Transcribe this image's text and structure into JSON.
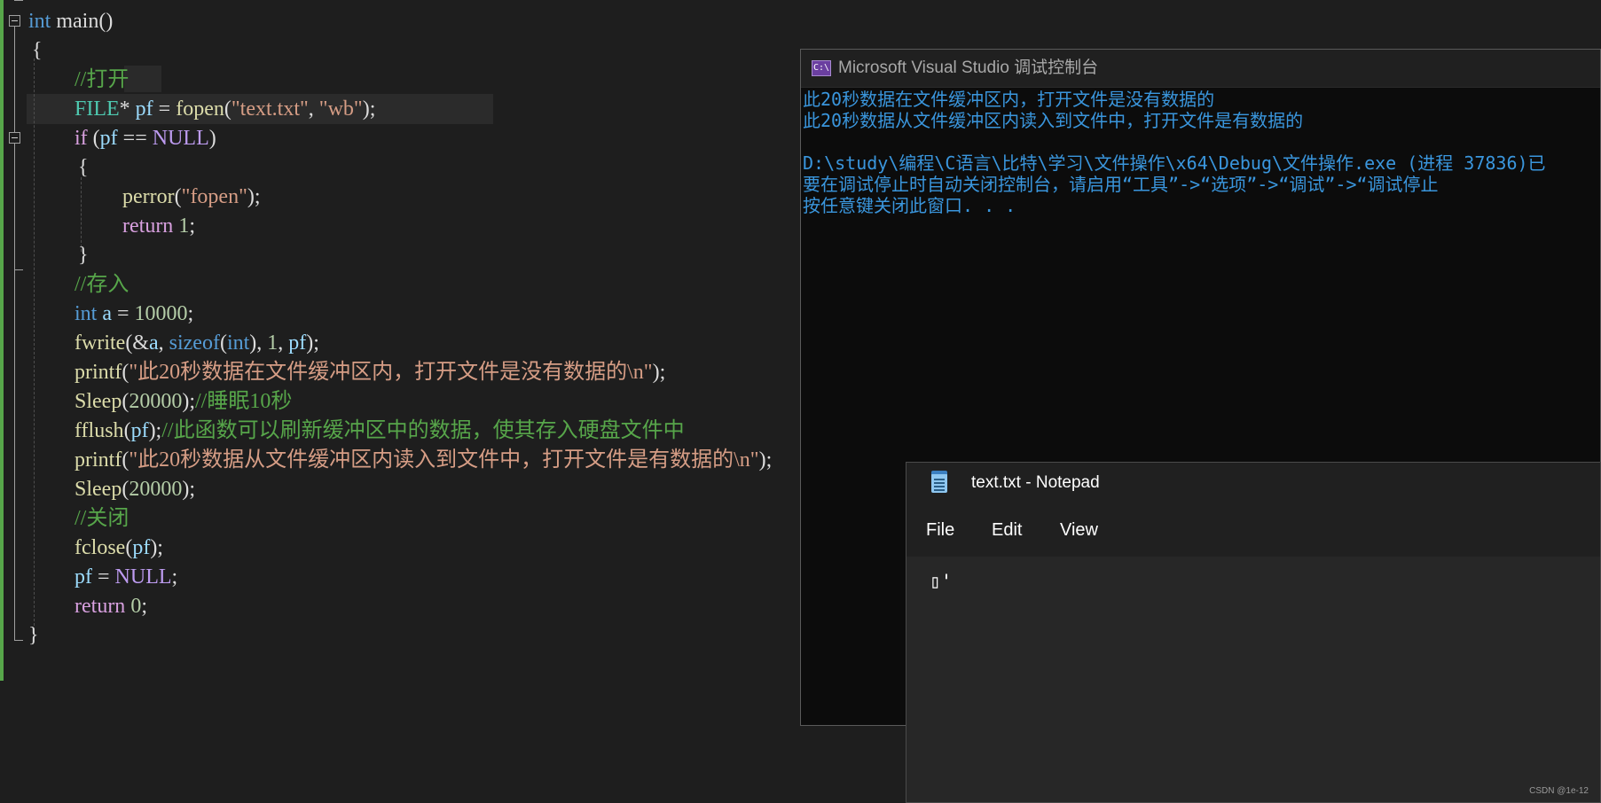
{
  "editor": {
    "lines": [
      {
        "tokens": [
          {
            "t": "int",
            "c": "kw"
          },
          {
            "t": " main()",
            "c": "pln"
          }
        ]
      },
      {
        "tokens": [
          {
            "t": "{",
            "c": "pln"
          }
        ]
      },
      {
        "tokens": [
          {
            "t": "//打开",
            "c": "cmt"
          }
        ]
      },
      {
        "tokens": [
          {
            "t": "FILE",
            "c": "typ"
          },
          {
            "t": "* ",
            "c": "pln"
          },
          {
            "t": "pf",
            "c": "var"
          },
          {
            "t": " = ",
            "c": "pln"
          },
          {
            "t": "fopen",
            "c": "fn"
          },
          {
            "t": "(",
            "c": "pln"
          },
          {
            "t": "\"text.txt\"",
            "c": "str"
          },
          {
            "t": ", ",
            "c": "pln"
          },
          {
            "t": "\"wb\"",
            "c": "str"
          },
          {
            "t": ");",
            "c": "pln"
          }
        ]
      },
      {
        "tokens": [
          {
            "t": "if",
            "c": "ctl"
          },
          {
            "t": " (",
            "c": "pln"
          },
          {
            "t": "pf",
            "c": "var"
          },
          {
            "t": " == ",
            "c": "pln"
          },
          {
            "t": "NULL",
            "c": "nul"
          },
          {
            "t": ")",
            "c": "pln"
          }
        ]
      },
      {
        "tokens": [
          {
            "t": "{",
            "c": "pln"
          }
        ]
      },
      {
        "tokens": [
          {
            "t": "perror",
            "c": "fn"
          },
          {
            "t": "(",
            "c": "pln"
          },
          {
            "t": "\"fopen\"",
            "c": "str"
          },
          {
            "t": ");",
            "c": "pln"
          }
        ]
      },
      {
        "tokens": [
          {
            "t": "return",
            "c": "ctl"
          },
          {
            "t": " ",
            "c": "pln"
          },
          {
            "t": "1",
            "c": "num"
          },
          {
            "t": ";",
            "c": "pln"
          }
        ]
      },
      {
        "tokens": [
          {
            "t": "}",
            "c": "pln"
          }
        ]
      },
      {
        "tokens": [
          {
            "t": "//存入",
            "c": "cmt"
          }
        ]
      },
      {
        "tokens": [
          {
            "t": "int",
            "c": "kw"
          },
          {
            "t": " ",
            "c": "pln"
          },
          {
            "t": "a",
            "c": "var"
          },
          {
            "t": " = ",
            "c": "pln"
          },
          {
            "t": "10000",
            "c": "num"
          },
          {
            "t": ";",
            "c": "pln"
          }
        ]
      },
      {
        "tokens": [
          {
            "t": "fwrite",
            "c": "fn"
          },
          {
            "t": "(&",
            "c": "pln"
          },
          {
            "t": "a",
            "c": "var"
          },
          {
            "t": ", ",
            "c": "pln"
          },
          {
            "t": "sizeof",
            "c": "kw"
          },
          {
            "t": "(",
            "c": "pln"
          },
          {
            "t": "int",
            "c": "kw"
          },
          {
            "t": "), ",
            "c": "pln"
          },
          {
            "t": "1",
            "c": "num"
          },
          {
            "t": ", ",
            "c": "pln"
          },
          {
            "t": "pf",
            "c": "var"
          },
          {
            "t": ");",
            "c": "pln"
          }
        ]
      },
      {
        "tokens": [
          {
            "t": "printf",
            "c": "fn"
          },
          {
            "t": "(",
            "c": "pln"
          },
          {
            "t": "\"此20秒数据在文件缓冲区内，打开文件是没有数据的\\n\"",
            "c": "str"
          },
          {
            "t": ");",
            "c": "pln"
          }
        ]
      },
      {
        "tokens": [
          {
            "t": "Sleep",
            "c": "fn"
          },
          {
            "t": "(",
            "c": "pln"
          },
          {
            "t": "20000",
            "c": "num"
          },
          {
            "t": ");",
            "c": "pln"
          },
          {
            "t": "//睡眠10秒",
            "c": "cmt"
          }
        ]
      },
      {
        "tokens": [
          {
            "t": "fflush",
            "c": "fn"
          },
          {
            "t": "(",
            "c": "pln"
          },
          {
            "t": "pf",
            "c": "var"
          },
          {
            "t": ");",
            "c": "pln"
          },
          {
            "t": "//此函数可以刷新缓冲区中的数据，使其存入硬盘文件中",
            "c": "cmt"
          }
        ]
      },
      {
        "tokens": [
          {
            "t": "printf",
            "c": "fn"
          },
          {
            "t": "(",
            "c": "pln"
          },
          {
            "t": "\"此20秒数据从文件缓冲区内读入到文件中，打开文件是有数据的\\n\"",
            "c": "str"
          },
          {
            "t": ");",
            "c": "pln"
          }
        ]
      },
      {
        "tokens": [
          {
            "t": "Sleep",
            "c": "fn"
          },
          {
            "t": "(",
            "c": "pln"
          },
          {
            "t": "20000",
            "c": "num"
          },
          {
            "t": ");",
            "c": "pln"
          }
        ]
      },
      {
        "tokens": [
          {
            "t": "//关闭",
            "c": "cmt"
          }
        ]
      },
      {
        "tokens": [
          {
            "t": "fclose",
            "c": "fn"
          },
          {
            "t": "(",
            "c": "pln"
          },
          {
            "t": "pf",
            "c": "var"
          },
          {
            "t": ");",
            "c": "pln"
          }
        ]
      },
      {
        "tokens": [
          {
            "t": "pf",
            "c": "var"
          },
          {
            "t": " = ",
            "c": "pln"
          },
          {
            "t": "NULL",
            "c": "nul"
          },
          {
            "t": ";",
            "c": "pln"
          }
        ]
      },
      {
        "tokens": [
          {
            "t": "return",
            "c": "ctl"
          },
          {
            "t": " ",
            "c": "pln"
          },
          {
            "t": "0",
            "c": "num"
          },
          {
            "t": ";",
            "c": "pln"
          }
        ]
      },
      {
        "tokens": [
          {
            "t": "}",
            "c": "pln"
          }
        ]
      }
    ]
  },
  "console": {
    "title": "Microsoft Visual Studio 调试控制台",
    "icon_text": "C:\\",
    "output": [
      "此20秒数据在文件缓冲区内，打开文件是没有数据的",
      "此20秒数据从文件缓冲区内读入到文件中，打开文件是有数据的",
      "",
      "D:\\study\\编程\\C语言\\比特\\学习\\文件操作\\x64\\Debug\\文件操作.exe (进程 37836)已",
      "要在调试停止时自动关闭控制台，请启用“工具”->“选项”->“调试”->“调试停止",
      "按任意键关闭此窗口. . ."
    ]
  },
  "notepad": {
    "title": "text.txt - Notepad",
    "menu": {
      "file": "File",
      "edit": "Edit",
      "view": "View"
    },
    "content": "▯'"
  },
  "watermark": "CSDN @1e-12",
  "colors": {
    "change_bar": "#57a64a",
    "console_text": "#3a96dd",
    "editor_bg": "#1e1e1e"
  }
}
